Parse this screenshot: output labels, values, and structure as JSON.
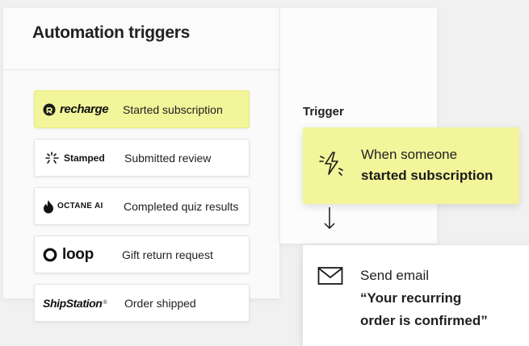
{
  "panel": {
    "title": "Automation triggers"
  },
  "triggers": [
    {
      "brand": "recharge",
      "label": "Started subscription",
      "active": true
    },
    {
      "brand": "Stamped",
      "label": "Submitted review"
    },
    {
      "brand": "OCTANE AI",
      "label": "Completed quiz results"
    },
    {
      "brand": "loop",
      "label": "Gift return request"
    },
    {
      "brand": "ShipStation",
      "label": "Order shipped"
    }
  ],
  "flow": {
    "section_label": "Trigger",
    "trigger_line1": "When someone",
    "trigger_line2": "started subscription",
    "action_title": "Send email",
    "action_line1": "“Your recurring",
    "action_line2": "order is confirmed”"
  },
  "icons": {
    "recharge": "recharge-logo-icon",
    "trigger": "lightning-bolt-icon",
    "flow_arrow": "arrow-down-icon",
    "email": "envelope-icon"
  },
  "colors": {
    "highlight": "#f2f59a",
    "text": "#1a1a1a",
    "background": "#f1f1f1"
  }
}
